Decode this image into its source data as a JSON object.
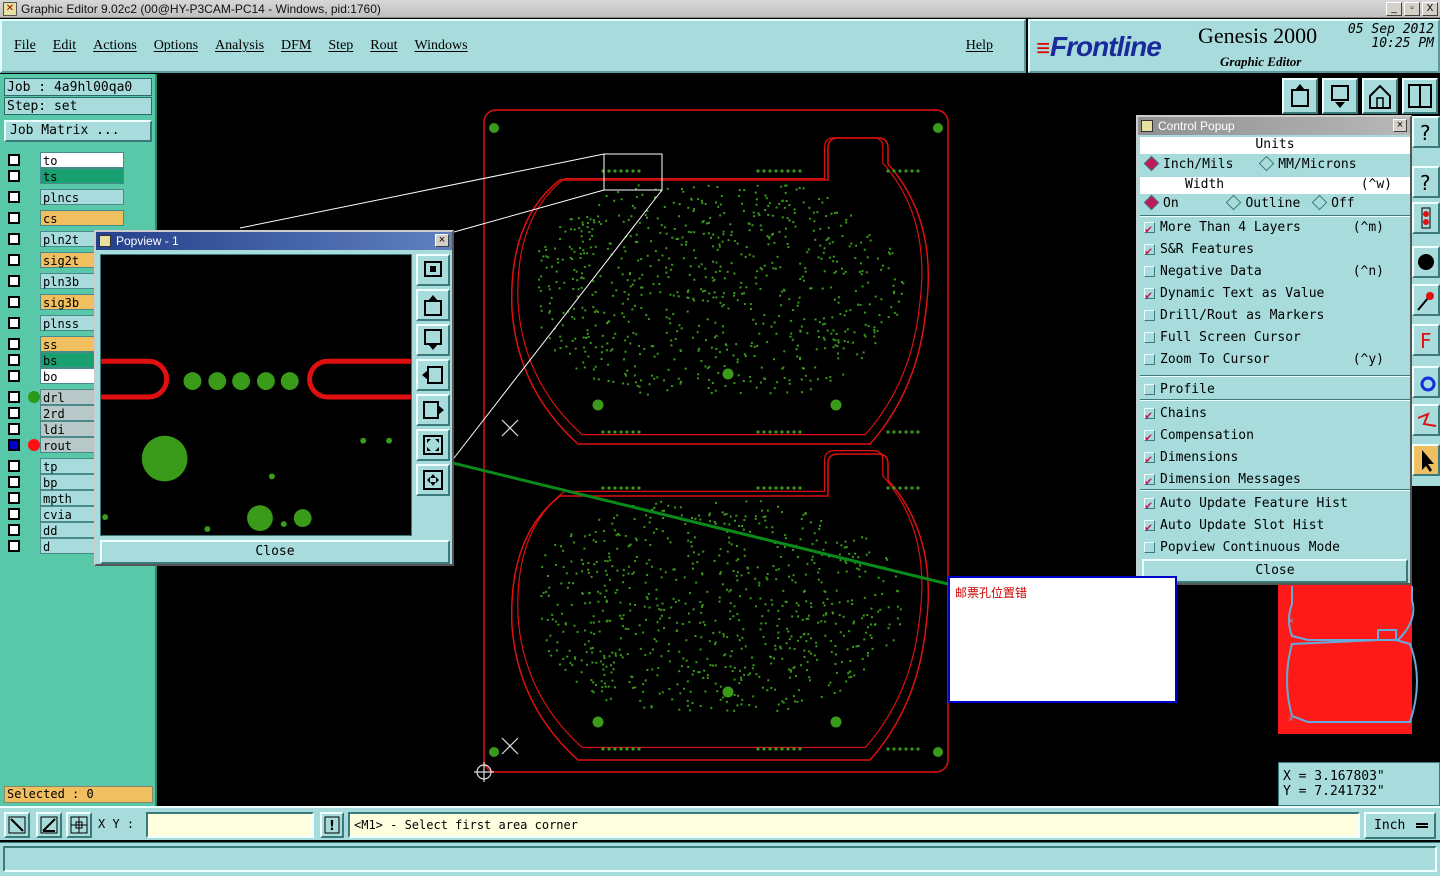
{
  "window": {
    "title": "Graphic Editor 9.02c2 (00@HY-P3CAM-PC14 - Windows, pid:1760)",
    "buttons": [
      "_",
      "▫",
      "X"
    ]
  },
  "menu": {
    "items": [
      "File",
      "Edit",
      "Actions",
      "Options",
      "Analysis",
      "DFM",
      "Step",
      "Rout",
      "Windows"
    ],
    "help": "Help"
  },
  "brand": {
    "logo": "Frontline",
    "product": "Genesis 2000",
    "subtitle": "Graphic Editor",
    "date": "05 Sep 2012",
    "time": "10:25 PM"
  },
  "job": {
    "job_line": "Job : 4a9hl00qa0",
    "step_line": "Step: set",
    "matrix_button": "Job Matrix ...",
    "selected": "Selected : 0"
  },
  "layers": [
    {
      "name": "to",
      "color": "#ffffff",
      "dot": ""
    },
    {
      "name": "ts",
      "color": "#18a070",
      "dot": ""
    },
    {
      "name": "plncs",
      "color": "#a8dcdc",
      "dot": ""
    },
    {
      "name": "cs",
      "color": "#f0c060",
      "dot": ""
    },
    {
      "name": "pln2t",
      "color": "#a8dcdc",
      "dot": ""
    },
    {
      "name": "sig2t",
      "color": "#f0c060",
      "dot": ""
    },
    {
      "name": "pln3b",
      "color": "#a8dcdc",
      "dot": ""
    },
    {
      "name": "sig3b",
      "color": "#f0c060",
      "dot": ""
    },
    {
      "name": "plnss",
      "color": "#a8dcdc",
      "dot": ""
    },
    {
      "name": "ss",
      "color": "#f0c060",
      "dot": ""
    },
    {
      "name": "bs",
      "color": "#18a070",
      "dot": ""
    },
    {
      "name": "bo",
      "color": "#ffffff",
      "dot": ""
    },
    {
      "name": "drl",
      "color": "#b8c8c8",
      "dot": "#2a9a1a"
    },
    {
      "name": "2rd",
      "color": "#b8c8c8",
      "dot": ""
    },
    {
      "name": "ldi",
      "color": "#b8c8c8",
      "dot": ""
    },
    {
      "name": "rout",
      "color": "#b8c8c8",
      "dot": "#ff1010"
    },
    {
      "name": "tp",
      "color": "#a8dcdc",
      "dot": ""
    },
    {
      "name": "bp",
      "color": "#a8dcdc",
      "dot": ""
    },
    {
      "name": "mpth",
      "color": "#a8dcdc",
      "dot": ""
    },
    {
      "name": "cvia",
      "color": "#a8dcdc",
      "dot": ""
    },
    {
      "name": "dd",
      "color": "#a8dcdc",
      "dot": ""
    },
    {
      "name": "d",
      "color": "#a8dcdc",
      "dot": ""
    }
  ],
  "popview": {
    "title": "Popview - 1",
    "close": "Close"
  },
  "control": {
    "title": "Control Popup",
    "units_header": "Units",
    "unit_inch": "Inch/Mils",
    "unit_mm": "MM/Microns",
    "width_header": "Width",
    "width_accel": "(^w)",
    "width_on": "On",
    "width_outline": "Outline",
    "width_off": "Off",
    "options": [
      {
        "label": "More Than 4 Layers",
        "accel": "(^m)",
        "checked": true
      },
      {
        "label": "S&R Features",
        "accel": "",
        "checked": true
      },
      {
        "label": "Negative Data",
        "accel": "(^n)",
        "checked": false
      },
      {
        "label": "Dynamic Text as Value",
        "accel": "",
        "checked": true
      },
      {
        "label": "Drill/Rout as Markers",
        "accel": "",
        "checked": false
      },
      {
        "label": "Full Screen Cursor",
        "accel": "",
        "checked": false
      },
      {
        "label": "Zoom To Cursor",
        "accel": "(^y)",
        "checked": false
      }
    ],
    "profile": {
      "label": "Profile",
      "checked": false
    },
    "display": [
      {
        "label": "Chains",
        "checked": true
      },
      {
        "label": "Compensation",
        "checked": true
      },
      {
        "label": "Dimensions",
        "checked": true
      },
      {
        "label": "Dimension Messages",
        "checked": true
      }
    ],
    "update": [
      {
        "label": "Auto Update Feature Hist",
        "checked": true
      },
      {
        "label": "Auto Update Slot Hist",
        "checked": true
      },
      {
        "label": "Popview Continuous Mode",
        "checked": false
      }
    ],
    "close": "Close"
  },
  "note": {
    "text": "邮票孔位置错"
  },
  "coords": {
    "x": "X = 3.167803\"",
    "y": "Y = 7.241732\""
  },
  "bottom": {
    "xy_label": "X Y :",
    "xy_value": "",
    "bang": "!",
    "prompt": "<M1> - Select first area corner",
    "units": "Inch"
  },
  "colors": {
    "panel": "#a8dcdc",
    "panel_dark": "#58c8a8",
    "rout": "#e01010",
    "pad": "#3a9a1a",
    "arrow": "#0a8a1a"
  },
  "icons": [
    "window-app-icon",
    "popview-window-icon",
    "control-popup-window-icon"
  ]
}
